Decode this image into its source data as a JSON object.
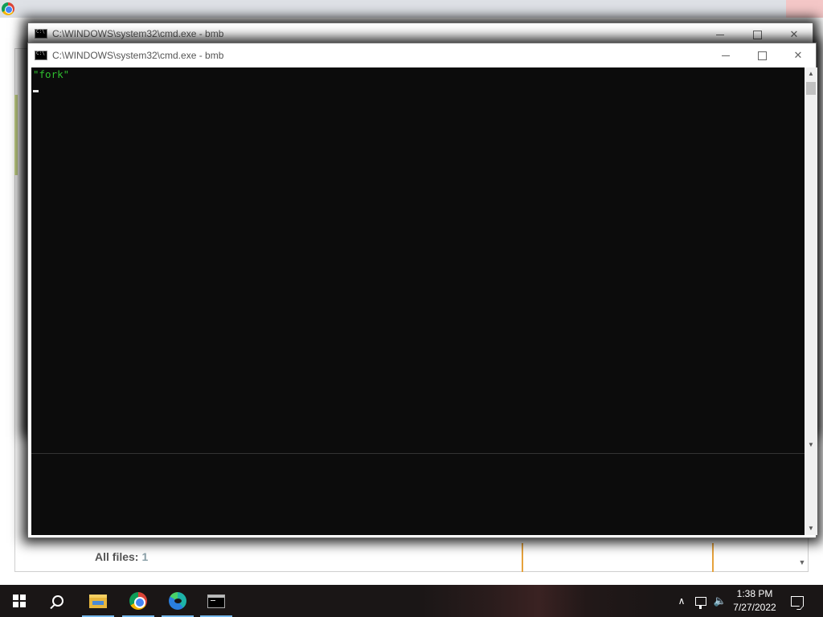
{
  "background_page": {
    "all_files_label": "All files:",
    "all_files_count": "1"
  },
  "cmd_back": {
    "title": "C:\\WINDOWS\\system32\\cmd.exe - bmb"
  },
  "cmd_front": {
    "title": "C:\\WINDOWS\\system32\\cmd.exe - bmb",
    "console_lines": [
      "\"fork\""
    ]
  },
  "taskbar": {
    "items": [
      "start",
      "search",
      "file-explorer",
      "chrome",
      "edge",
      "command-prompt"
    ],
    "clock_time": "1:38 PM",
    "clock_date": "7/27/2022"
  },
  "colors": {
    "console_bg": "#0c0c0c",
    "console_text": "#2fbf2f",
    "taskbar_bg": "#1a1616",
    "taskbar_active_underline": "#76b9ed"
  },
  "icons": {
    "window_minimize": "minimize-icon",
    "window_maximize": "maximize-icon",
    "window_close": "close-icon",
    "tray": [
      "chevron-up-icon",
      "network-icon",
      "volume-icon",
      "notification-icon"
    ]
  }
}
